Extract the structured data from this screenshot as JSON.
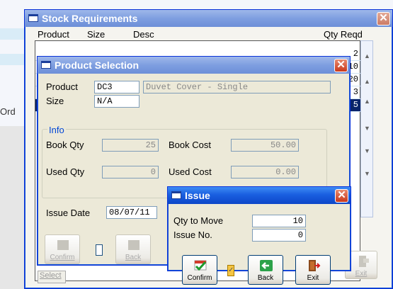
{
  "background": {
    "partial_label": "Ord"
  },
  "stock_window": {
    "title": "Stock Requirements",
    "columns": {
      "product": "Product",
      "size": "Size",
      "desc": "Desc",
      "qty": "Qty Reqd"
    },
    "rows": [
      {
        "qty": "2"
      },
      {
        "qty": "10"
      },
      {
        "qty": "20"
      },
      {
        "qty": "3"
      },
      {
        "qty": "5",
        "selected": true
      }
    ],
    "buttons": {
      "select": "Select",
      "exit": "Exit"
    }
  },
  "product_window": {
    "title": "Product Selection",
    "product_label": "Product",
    "product_code": "DC3",
    "product_desc": "Duvet Cover - Single",
    "size_label": "Size",
    "size_value": "N/A",
    "info_title": "Info",
    "book_qty_label": "Book Qty",
    "book_qty": "25",
    "book_cost_label": "Book Cost",
    "book_cost": "50.00",
    "used_qty_label": "Used Qty",
    "used_qty": "0",
    "used_cost_label": "Used Cost",
    "used_cost": "0.00",
    "issue_date_label": "Issue Date",
    "issue_date": "08/07/11",
    "buttons": {
      "confirm": "Confirm",
      "back": "Back"
    }
  },
  "issue_window": {
    "title": "Issue",
    "qty_label": "Qty to Move",
    "qty_value": "10",
    "issue_no_label": "Issue No.",
    "issue_no_value": "0",
    "buttons": {
      "confirm": "Confirm",
      "back": "Back",
      "exit": "Exit"
    }
  },
  "colors": {
    "title_active": "#0c46c8",
    "title_inactive": "#7e9ee0",
    "selection": "#0a246a"
  }
}
